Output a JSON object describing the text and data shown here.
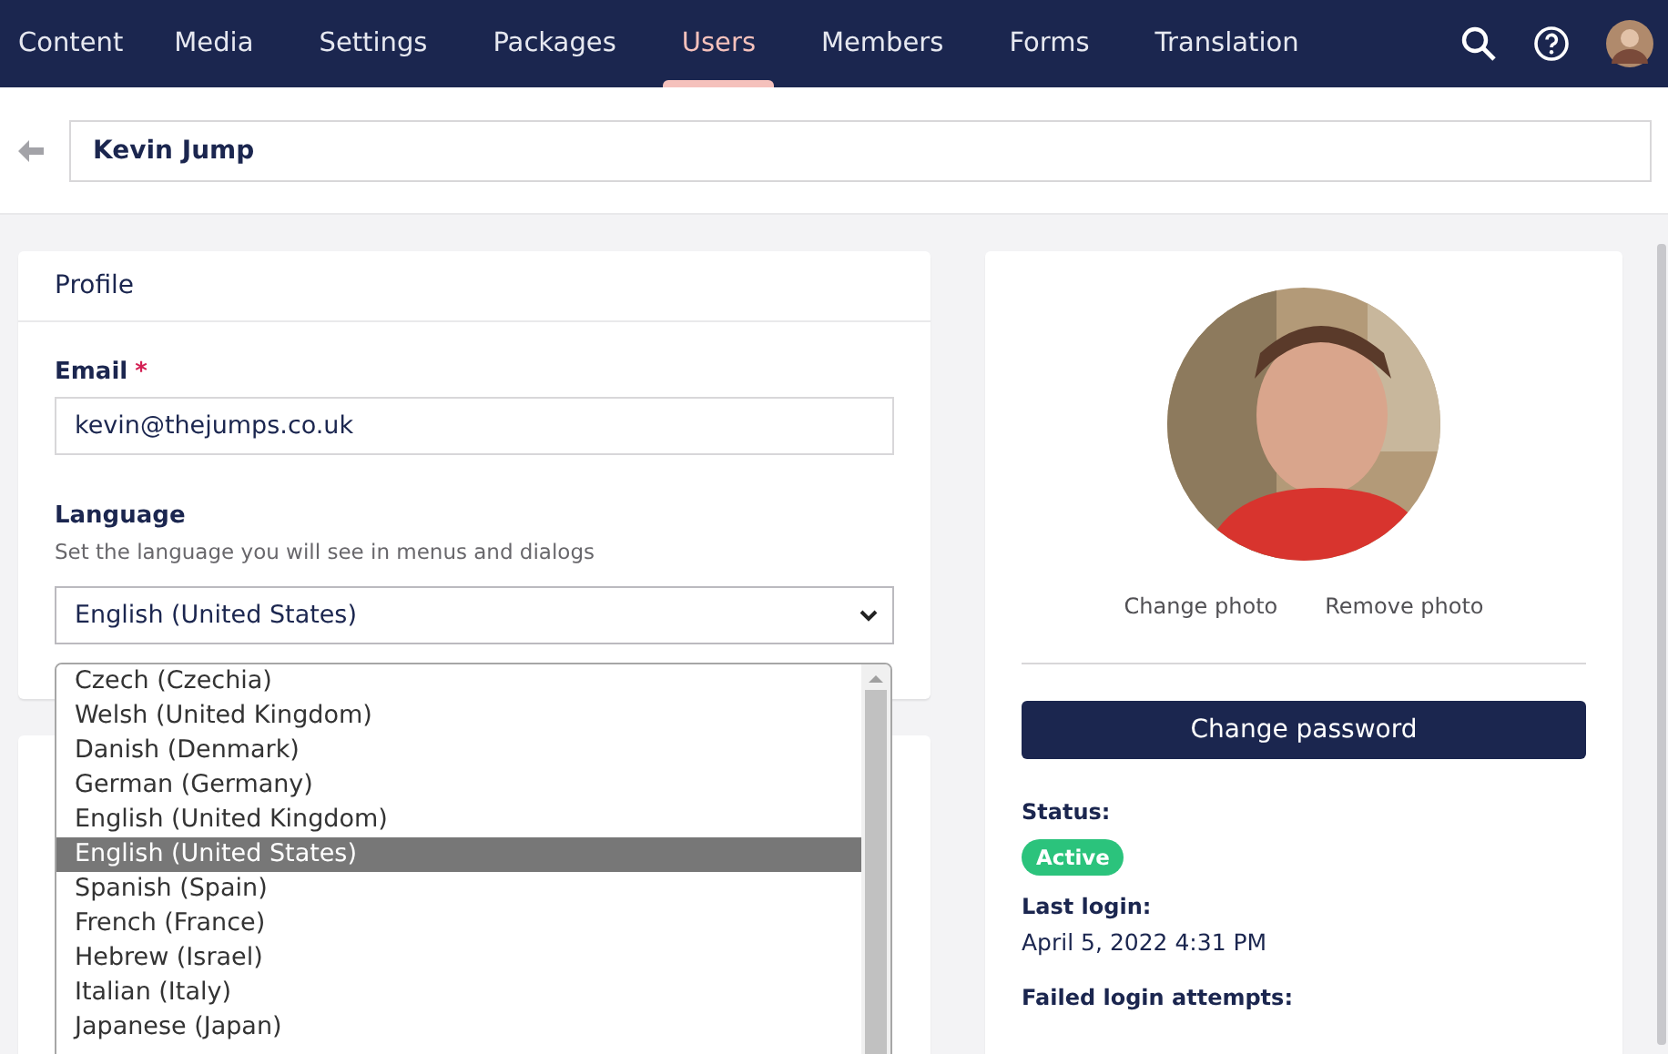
{
  "nav": {
    "items": [
      {
        "label": "Content",
        "selected": false
      },
      {
        "label": "Media",
        "selected": false
      },
      {
        "label": "Settings",
        "selected": false
      },
      {
        "label": "Packages",
        "selected": false
      },
      {
        "label": "Users",
        "selected": true
      },
      {
        "label": "Members",
        "selected": false
      },
      {
        "label": "Forms",
        "selected": false
      },
      {
        "label": "Translation",
        "selected": false
      }
    ]
  },
  "header": {
    "name": "Kevin Jump"
  },
  "profile": {
    "title": "Profile",
    "email_label": "Email",
    "email_required_mark": "*",
    "email": "kevin@thejumps.co.uk",
    "language_label": "Language",
    "language_hint": "Set the language you will see in menus and dialogs",
    "language_value": "English (United States)",
    "language_options": [
      {
        "label": "Czech (Czechia)",
        "selected": false
      },
      {
        "label": "Welsh (United Kingdom)",
        "selected": false
      },
      {
        "label": "Danish (Denmark)",
        "selected": false
      },
      {
        "label": "German (Germany)",
        "selected": false
      },
      {
        "label": "English (United Kingdom)",
        "selected": false
      },
      {
        "label": "English (United States)",
        "selected": true
      },
      {
        "label": "Spanish (Spain)",
        "selected": false
      },
      {
        "label": "French (France)",
        "selected": false
      },
      {
        "label": "Hebrew (Israel)",
        "selected": false
      },
      {
        "label": "Italian (Italy)",
        "selected": false
      },
      {
        "label": "Japanese (Japan)",
        "selected": false
      }
    ]
  },
  "account": {
    "change_photo": "Change photo",
    "remove_photo": "Remove photo",
    "change_password": "Change password",
    "status_label": "Status:",
    "status": {
      "label": "Active",
      "kind": "active"
    },
    "last_login_label": "Last login:",
    "last_login": "April 5, 2022 4:31 PM",
    "failed_label": "Failed login attempts:"
  }
}
